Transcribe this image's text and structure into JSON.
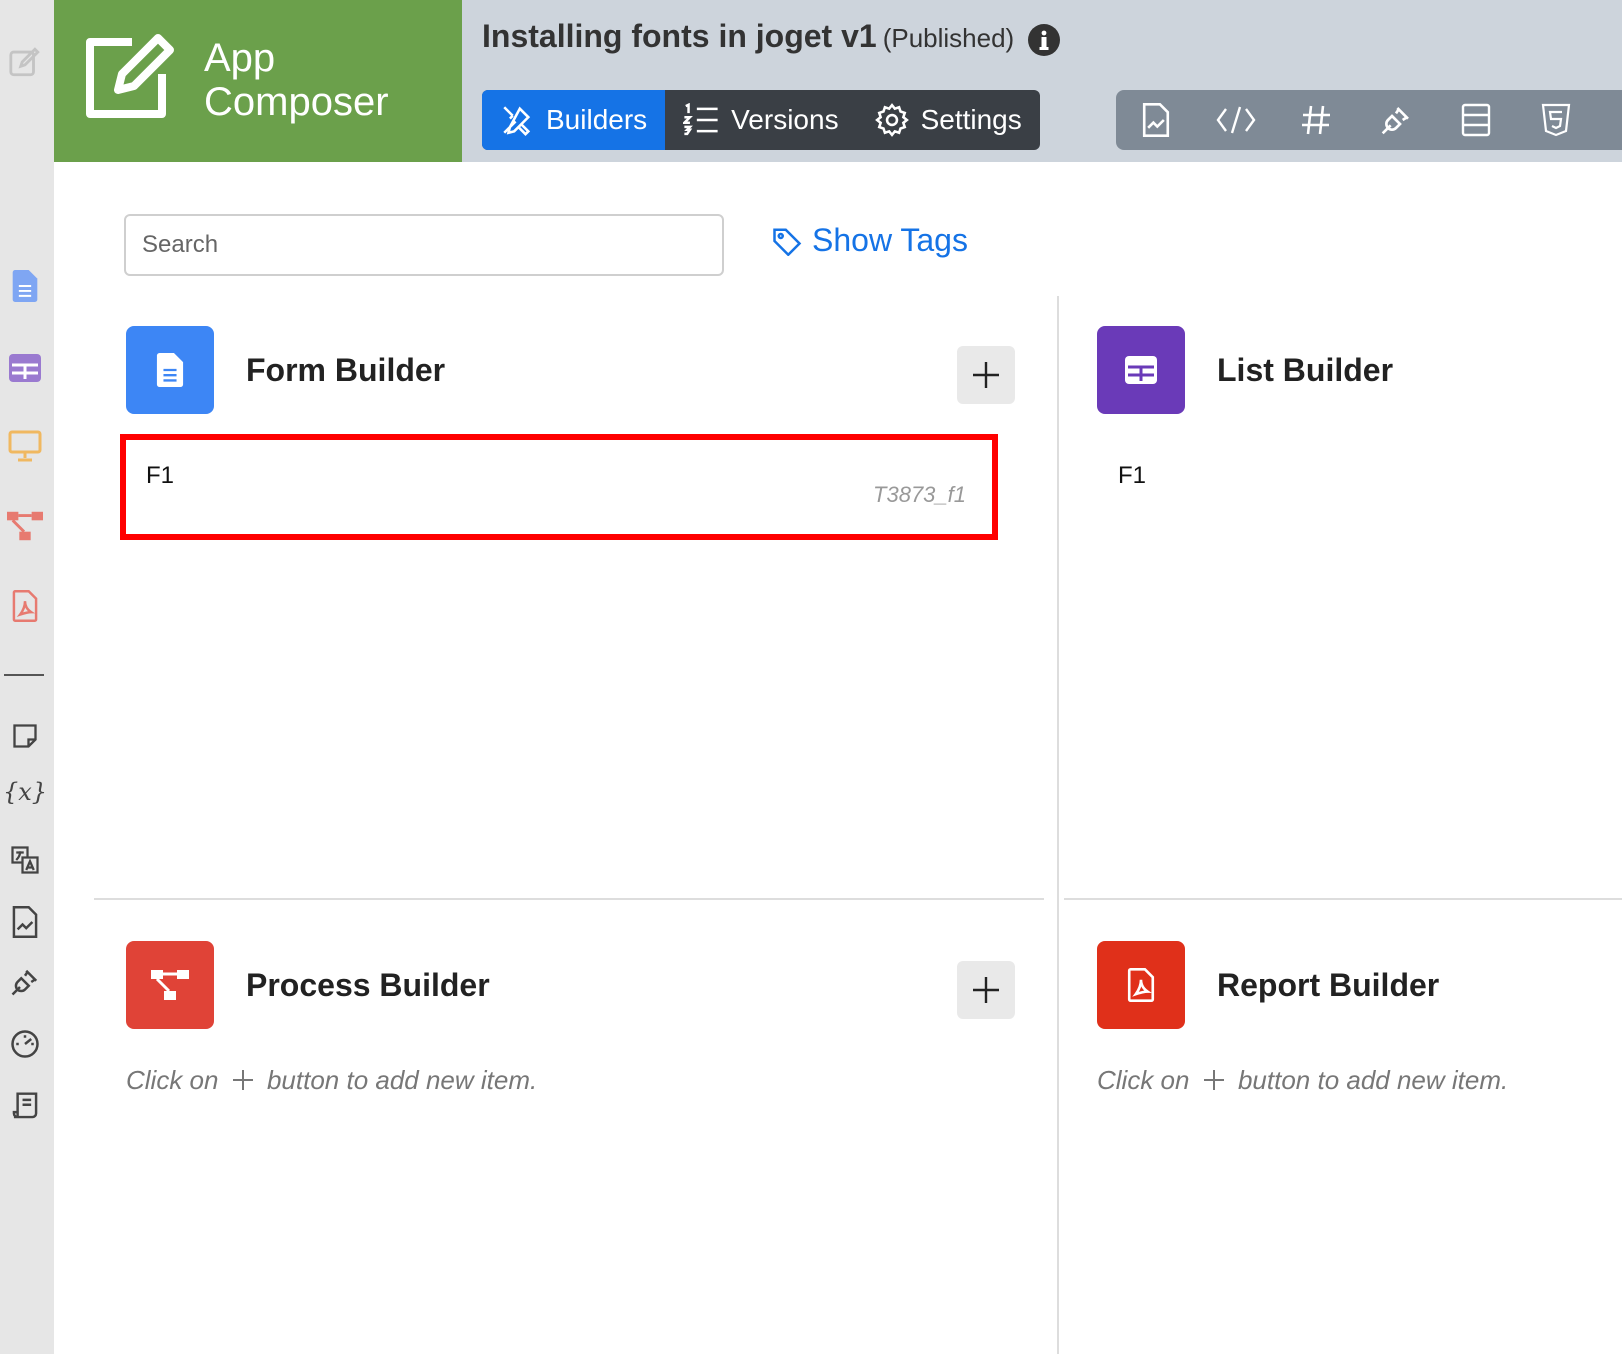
{
  "header": {
    "brand_line1": "App",
    "brand_line2": "Composer",
    "app_name": "Installing fonts in joget v1",
    "app_status": "(Published)"
  },
  "nav": {
    "builders": "Builders",
    "versions": "Versions",
    "settings": "Settings"
  },
  "search": {
    "placeholder": "Search"
  },
  "show_tags": "Show Tags",
  "builders": {
    "form": {
      "title": "Form Builder",
      "items": [
        {
          "name": "F1",
          "id": "T3873_f1"
        }
      ]
    },
    "list": {
      "title": "List Builder",
      "items": [
        {
          "name": "F1"
        }
      ]
    },
    "process": {
      "title": "Process Builder",
      "empty_before": "Click on",
      "empty_after": "button to add new item."
    },
    "report": {
      "title": "Report Builder",
      "empty_before": "Click on",
      "empty_after": "button to add new item."
    }
  },
  "colors": {
    "brand": "#6ba04b",
    "accent": "#1573e6",
    "form": "#3d86f5",
    "list": "#6a3ab8",
    "process": "#e04337",
    "report": "#e0301a",
    "highlight": "#ff0000"
  }
}
